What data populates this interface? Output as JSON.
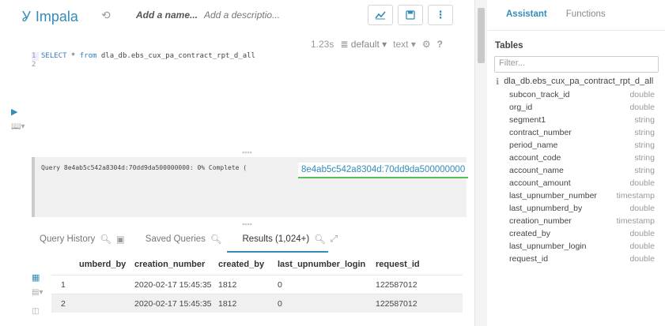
{
  "app": {
    "name": "Impala",
    "name_placeholder": "Add a name...",
    "desc_placeholder": "Add a descriptio..."
  },
  "editor_meta": {
    "time": "1.23s",
    "database": "default",
    "mode": "text"
  },
  "editor": {
    "gutter": [
      "1",
      "2"
    ],
    "keyword_select": "SELECT",
    "line1_rest_1": " * ",
    "keyword_from": "from",
    "line1_rest_2": " dla_db.ebs_cux_pa_contract_rpt_d_all"
  },
  "log": {
    "text": "Query 8e4ab5c542a8304d:70dd9da500000000: 0% Complete (",
    "tooltip": "8e4ab5c542a8304d:70dd9da500000000"
  },
  "tabs": [
    {
      "label": "Query History"
    },
    {
      "label": "Saved Queries"
    },
    {
      "label": "Results (1,024+)"
    }
  ],
  "results": {
    "columns": [
      "",
      "umberd_by",
      "creation_number",
      "created_by",
      "last_upnumber_login",
      "request_id"
    ],
    "rows": [
      [
        "1",
        "",
        "2020-02-17 15:45:35",
        "1812",
        "0",
        "122587012"
      ],
      [
        "2",
        "",
        "2020-02-17 15:45:35",
        "1812",
        "0",
        "122587012"
      ]
    ]
  },
  "right_panel": {
    "tabs": [
      "Assistant",
      "Functions"
    ],
    "title": "Tables",
    "filter_placeholder": "Filter...",
    "table_name": "dla_db.ebs_cux_pa_contract_rpt_d_all",
    "columns": [
      {
        "name": "subcon_track_id",
        "type": "double"
      },
      {
        "name": "org_id",
        "type": "double"
      },
      {
        "name": "segment1",
        "type": "string"
      },
      {
        "name": "contract_number",
        "type": "string"
      },
      {
        "name": "period_name",
        "type": "string"
      },
      {
        "name": "account_code",
        "type": "string"
      },
      {
        "name": "account_name",
        "type": "string"
      },
      {
        "name": "account_amount",
        "type": "double"
      },
      {
        "name": "last_upnumber_number",
        "type": "timestamp"
      },
      {
        "name": "last_upnumberd_by",
        "type": "double"
      },
      {
        "name": "creation_number",
        "type": "timestamp"
      },
      {
        "name": "created_by",
        "type": "double"
      },
      {
        "name": "last_upnumber_login",
        "type": "double"
      },
      {
        "name": "request_id",
        "type": "double"
      }
    ]
  },
  "colors": {
    "accent": "#338bb8",
    "success": "#5bbc5b"
  }
}
